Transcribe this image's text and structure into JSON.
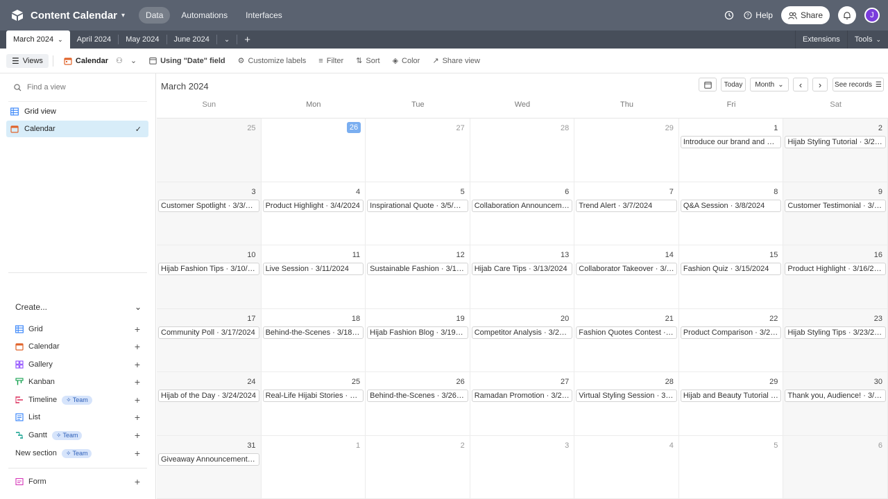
{
  "header": {
    "title": "Content Calendar",
    "nav": [
      "Data",
      "Automations",
      "Interfaces"
    ],
    "help": "Help",
    "share": "Share",
    "avatar": "J"
  },
  "tabs": {
    "items": [
      "March 2024",
      "April 2024",
      "May 2024",
      "June 2024"
    ],
    "extensions": "Extensions",
    "tools": "Tools"
  },
  "toolbar": {
    "views": "Views",
    "calendar": "Calendar",
    "date_field": "Using \"Date\" field",
    "customize": "Customize labels",
    "filter": "Filter",
    "sort": "Sort",
    "color": "Color",
    "share_view": "Share view"
  },
  "sidebar": {
    "find_placeholder": "Find a view",
    "views": [
      "Grid view",
      "Calendar"
    ],
    "create_label": "Create...",
    "create_items": [
      "Grid",
      "Calendar",
      "Gallery",
      "Kanban",
      "Timeline",
      "List",
      "Gantt",
      "New section",
      "Form"
    ],
    "team_badge": "Team"
  },
  "calendar": {
    "month_label": "March 2024",
    "today": "Today",
    "mode": "Month",
    "see_records": "See records",
    "prev": "‹",
    "next": "›",
    "weekdays": [
      "Sun",
      "Mon",
      "Tue",
      "Wed",
      "Thu",
      "Fri",
      "Sat"
    ],
    "weeks": [
      [
        {
          "d": "25",
          "m": true
        },
        {
          "d": "26",
          "today": true
        },
        {
          "d": "27",
          "m": true
        },
        {
          "d": "28",
          "m": true
        },
        {
          "d": "29",
          "m": true
        },
        {
          "d": "1",
          "ev": "Introduce our brand and mis..."
        },
        {
          "d": "2",
          "ev": "Hijab Styling Tutorial · 3/2/2..."
        }
      ],
      [
        {
          "d": "3",
          "ev": "Customer Spotlight · 3/3/2024"
        },
        {
          "d": "4",
          "ev": "Product Highlight · 3/4/2024"
        },
        {
          "d": "5",
          "ev": "Inspirational Quote · 3/5/2024"
        },
        {
          "d": "6",
          "ev": "Collaboration Announcemen..."
        },
        {
          "d": "7",
          "ev": "Trend Alert  · 3/7/2024"
        },
        {
          "d": "8",
          "ev": "Q&A Session · 3/8/2024"
        },
        {
          "d": "9",
          "ev": "Customer Testimonial · 3/9/2..."
        }
      ],
      [
        {
          "d": "10",
          "ev": "Hijab Fashion Tips · 3/10/2024"
        },
        {
          "d": "11",
          "ev": "Live Session · 3/11/2024"
        },
        {
          "d": "12",
          "ev": "Sustainable Fashion · 3/12/2..."
        },
        {
          "d": "13",
          "ev": "Hijab Care Tips · 3/13/2024"
        },
        {
          "d": "14",
          "ev": "Collaborator Takeover  · 3/14..."
        },
        {
          "d": "15",
          "ev": "Fashion Quiz · 3/15/2024"
        },
        {
          "d": "16",
          "ev": "Product Highlight · 3/16/2024"
        }
      ],
      [
        {
          "d": "17",
          "ev": "Community Poll · 3/17/2024"
        },
        {
          "d": "18",
          "ev": "Behind-the-Scenes · 3/18/20..."
        },
        {
          "d": "19",
          "ev": "Hijab Fashion Blog · 3/19/20..."
        },
        {
          "d": "20",
          "ev": "Competitor Analysis · 3/20/2..."
        },
        {
          "d": "21",
          "ev": "Fashion Quotes Contest · 3/..."
        },
        {
          "d": "22",
          "ev": "Product Comparison · 3/22/..."
        },
        {
          "d": "23",
          "ev": "Hijab Styling Tips · 3/23/2024"
        }
      ],
      [
        {
          "d": "24",
          "ev": "Hijab of the Day · 3/24/2024"
        },
        {
          "d": "25",
          "ev": "Real-Life Hijabi Stories  · 3/2..."
        },
        {
          "d": "26",
          "ev": "Behind-the-Scenes · 3/26/20..."
        },
        {
          "d": "27",
          "ev": "Ramadan Promotion · 3/27/..."
        },
        {
          "d": "28",
          "ev": "Virtual Styling Session · 3/28..."
        },
        {
          "d": "29",
          "ev": "Hijab and Beauty Tutorial · 3..."
        },
        {
          "d": "30",
          "ev": "Thank you, Audience! · 3/30/..."
        }
      ],
      [
        {
          "d": "31",
          "ev": "Giveaway Announcement · 3..."
        },
        {
          "d": "1",
          "m": true
        },
        {
          "d": "2",
          "m": true
        },
        {
          "d": "3",
          "m": true
        },
        {
          "d": "4",
          "m": true
        },
        {
          "d": "5",
          "m": true
        },
        {
          "d": "6",
          "m": true
        }
      ]
    ]
  },
  "colors": {
    "header_bg": "#5a6270",
    "tabs_bg": "#474e5a",
    "today": "#7aaef0",
    "selected_view": "#d8edf9"
  }
}
